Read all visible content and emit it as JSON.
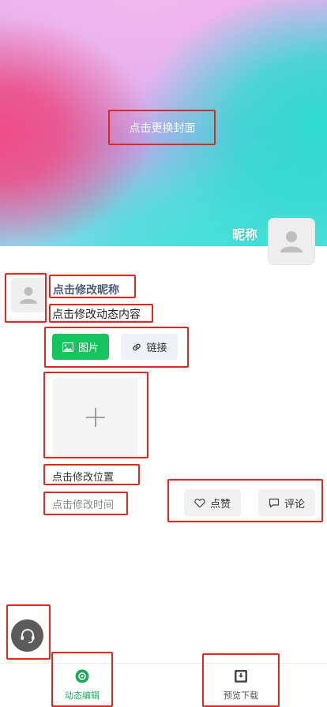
{
  "cover": {
    "change_cover_label": "点击更换封面",
    "nickname": "昵称"
  },
  "post": {
    "nickname": "点击修改昵称",
    "content": "点击修改动态内容",
    "image_button": "图片",
    "link_button": "链接",
    "location": "点击修改位置",
    "time": "点击修改时间",
    "like_button": "点赞",
    "comment_button": "评论"
  },
  "tabs": [
    {
      "label": "动态编辑",
      "icon": "edit-circle-icon",
      "active": true
    },
    {
      "label": "预览下载",
      "icon": "download-box-icon",
      "active": false
    }
  ],
  "colors": {
    "accent_green": "#15c45e",
    "annotation_red": "#e4261e",
    "nickname_blue": "#4e5d7e"
  }
}
